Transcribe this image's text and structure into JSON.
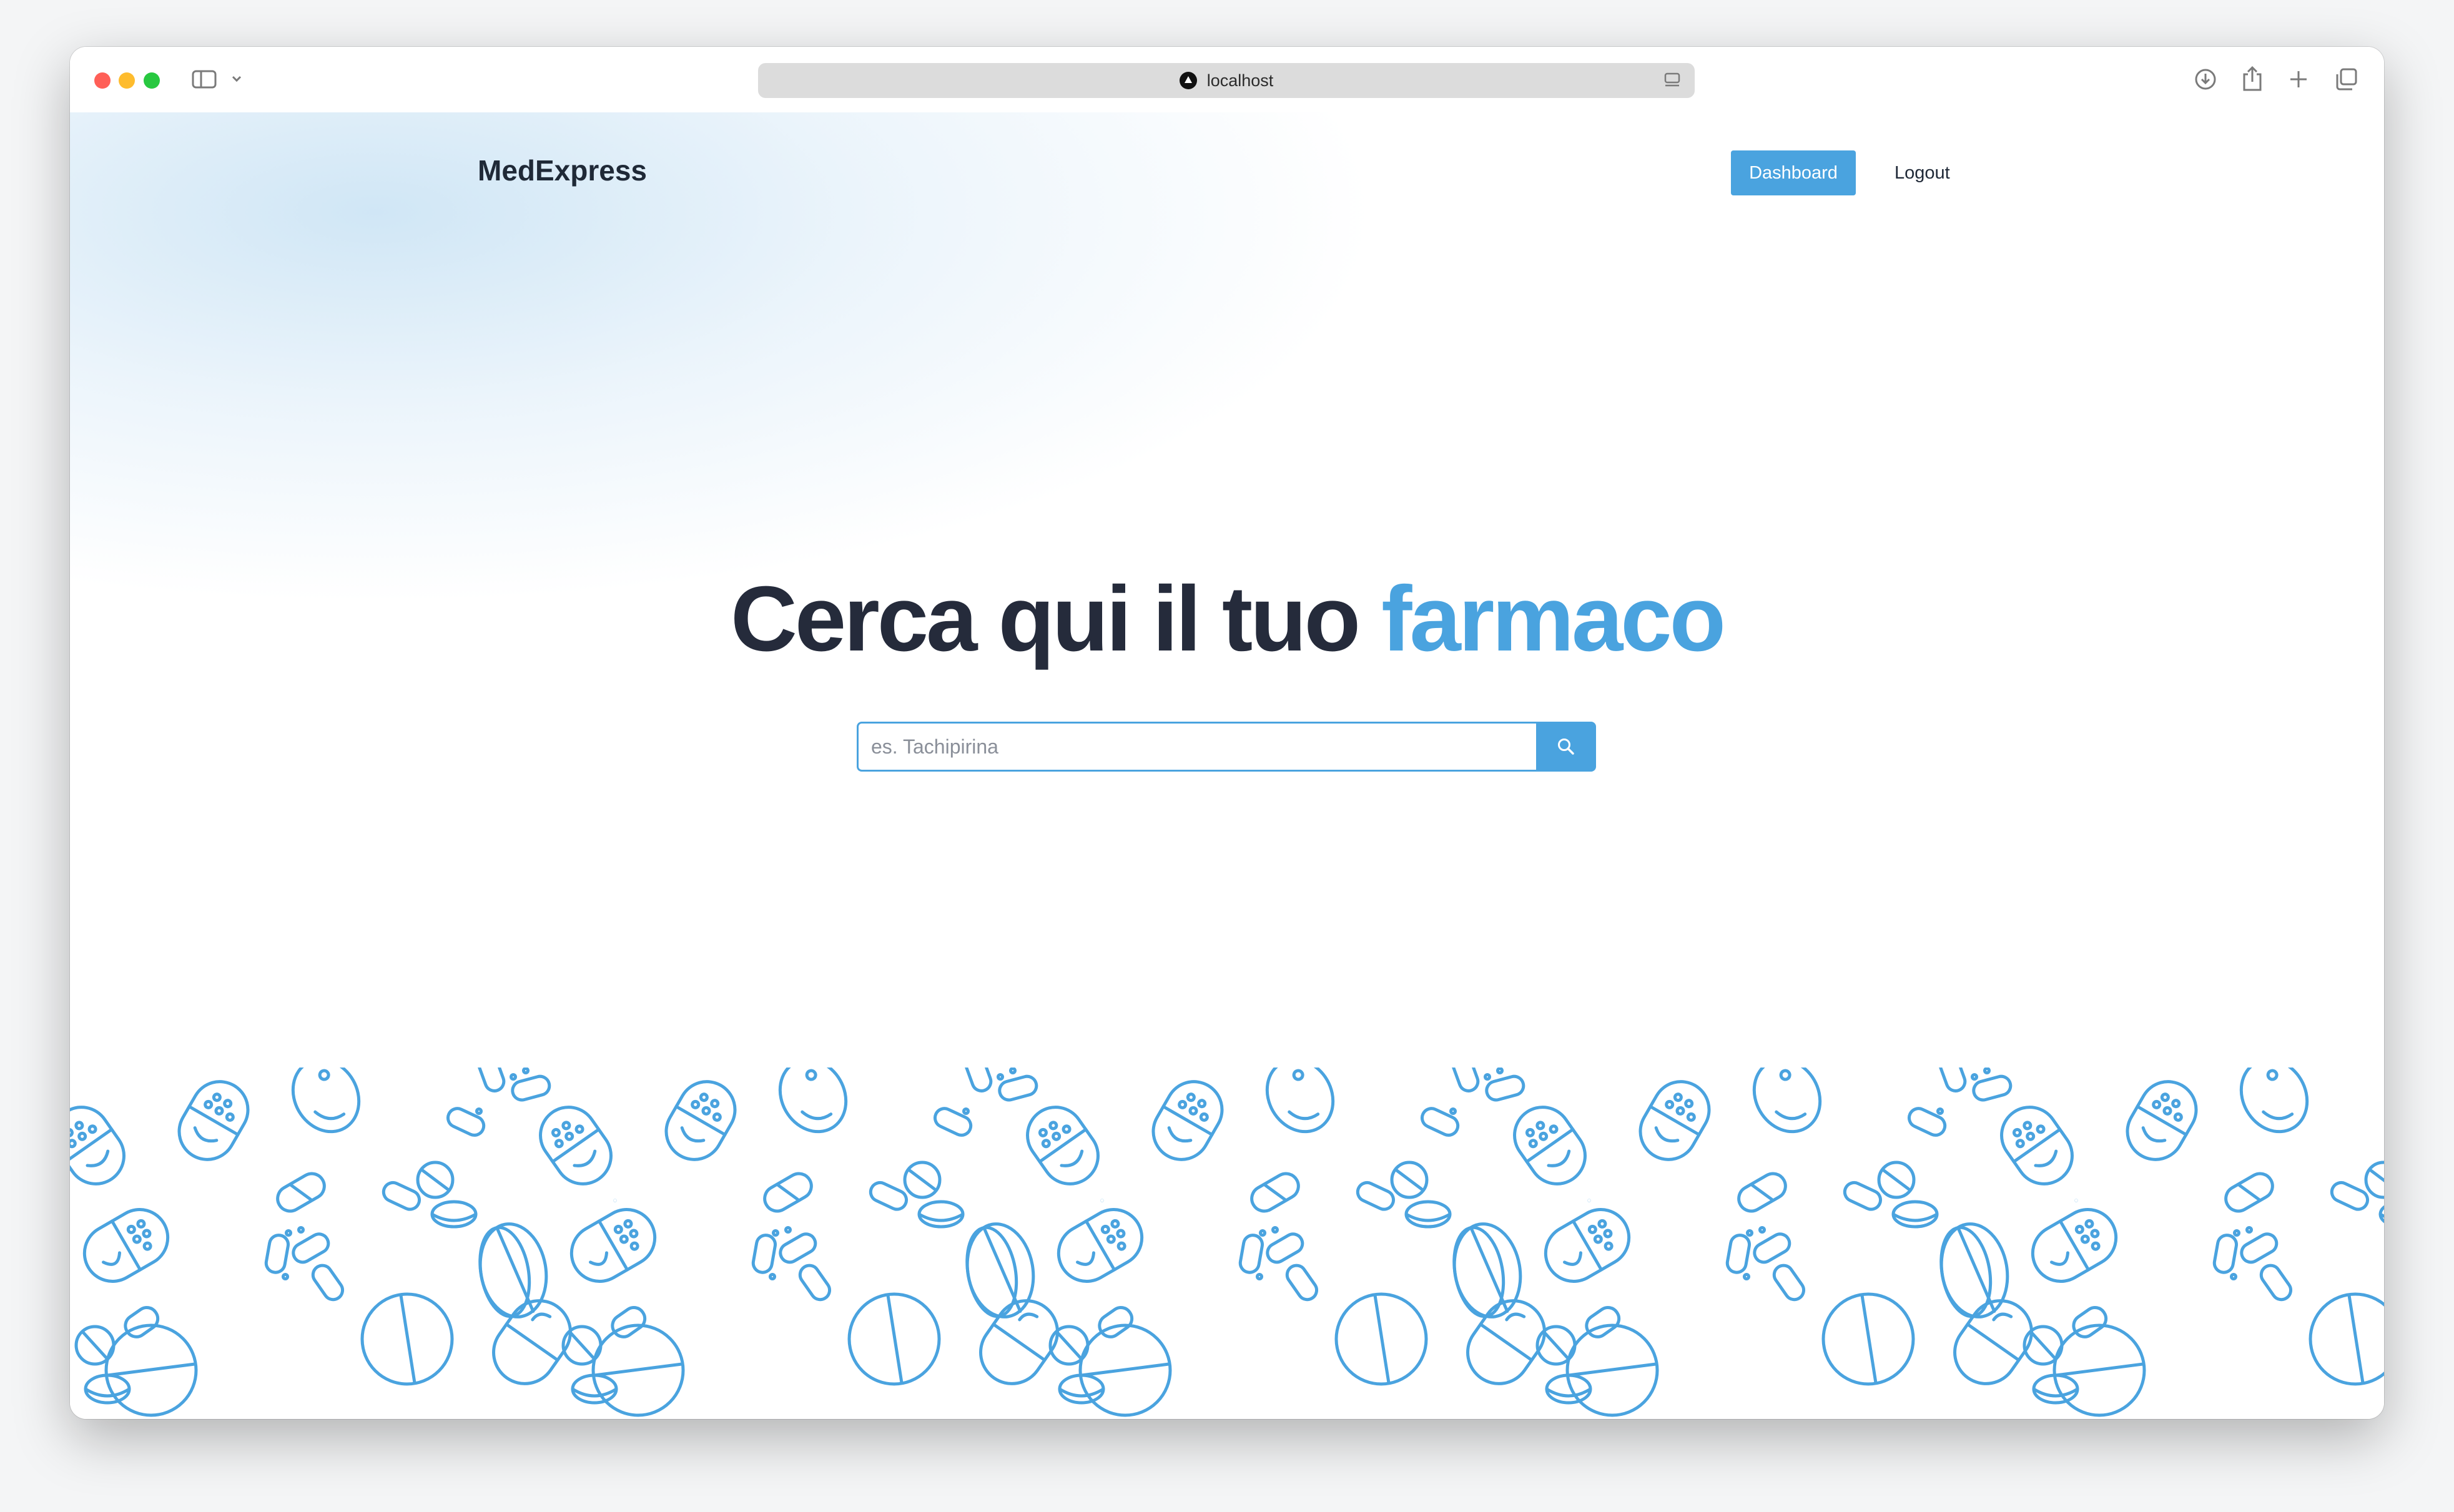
{
  "browser": {
    "url": "localhost",
    "icons": [
      "sidebar-icon",
      "chevron-down-icon",
      "download-icon",
      "share-icon",
      "plus-icon",
      "tabs-icon",
      "reader-icon"
    ]
  },
  "nav": {
    "brand": "MedExpress",
    "dashboard_label": "Dashboard",
    "logout_label": "Logout"
  },
  "hero": {
    "title_main": "Cerca qui il tuo ",
    "title_accent": "farmaco"
  },
  "search": {
    "placeholder": "es. Tachipirina",
    "value": ""
  },
  "colors": {
    "accent": "#4aa3df",
    "heading": "#252b3b",
    "illustration": "#4aa3df"
  }
}
